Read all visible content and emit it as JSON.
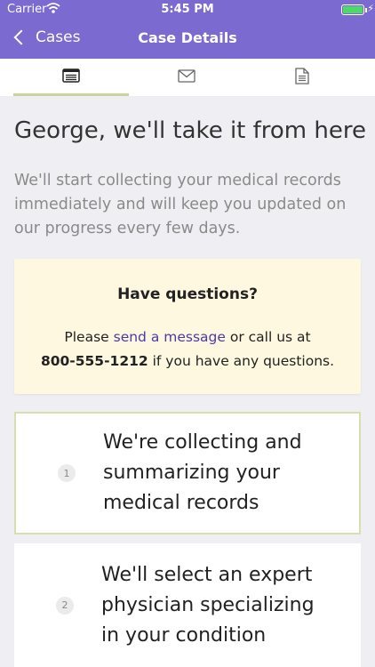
{
  "status_bar": {
    "carrier": "Carrier",
    "time": "5:45 PM"
  },
  "nav": {
    "back_label": "Cases",
    "title": "Case Details"
  },
  "tabs": [
    {
      "icon": "list-icon",
      "active": true
    },
    {
      "icon": "envelope-icon",
      "active": false
    },
    {
      "icon": "document-icon",
      "active": false
    }
  ],
  "main": {
    "heading": "George, we'll take it from here",
    "intro": "We'll start collecting your medical records immediately and will keep you updated on our progress every few days."
  },
  "questions": {
    "title": "Have questions?",
    "body_prefix": "Please ",
    "link_text": "send a message",
    "body_middle": " or call us at",
    "phone": "800-555-1212",
    "body_suffix": " if you have any questions."
  },
  "steps": [
    {
      "number": "1",
      "line1": "We're collecting and",
      "line2": "summarizing your",
      "line3": "medical records"
    },
    {
      "number": "2",
      "line1": "We'll select an expert",
      "line2": "physician specializing",
      "line3": "in your condition"
    }
  ],
  "colors": {
    "header": "#7b6ad0",
    "active_tab": "#c8d49a",
    "link": "#4b3aa8",
    "questions_bg": "#fdf8df"
  }
}
